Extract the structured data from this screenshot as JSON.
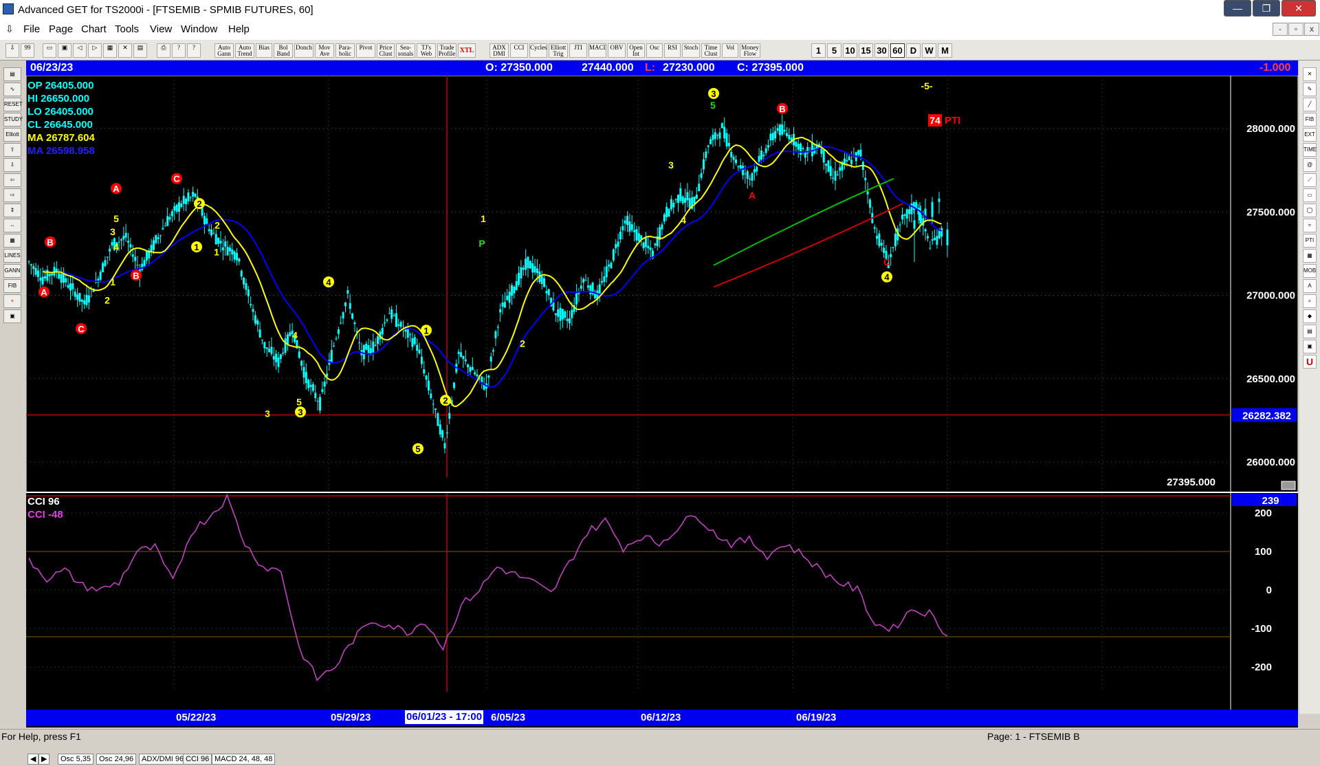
{
  "window": {
    "title": "Advanced GET for TS2000i - [FTSEMIB - SPMIB FUTURES, 60]",
    "controls": [
      "—",
      "❐",
      "✕"
    ]
  },
  "menu": {
    "items": [
      "File",
      "Page",
      "Chart",
      "Tools",
      "View",
      "Window",
      "Help"
    ],
    "mdi_controls": [
      "-",
      "▫",
      "x"
    ]
  },
  "toolbar": {
    "indicator_buttons": [
      "Auto Gann",
      "Auto Trend",
      "Bias",
      "Bol Band",
      "Donch",
      "Mov Ave",
      "Para-bolic",
      "Pivot",
      "Price Clust",
      "Sea-sonals",
      "TJ's Web",
      "Trade Profile",
      "XTL",
      "ADX DMI",
      "CCI",
      "Cycles",
      "Elliott Trig",
      "JTI",
      "MACD",
      "OBV",
      "Open Int",
      "Osc",
      "RSI",
      "Stoch",
      "Time Clust",
      "Vol",
      "Money Flow"
    ],
    "periods": [
      "1",
      "5",
      "10",
      "15",
      "30",
      "60",
      "D",
      "W",
      "M"
    ],
    "active_period": "60"
  },
  "header": {
    "date": "06/23/23",
    "open": "O: 27350.000",
    "high": "27440.000",
    "low_label": "L:",
    "low_value": "27230.000",
    "close": "C: 27395.000",
    "change": "-1.000"
  },
  "legend": {
    "op": "OP  26405.000",
    "hi": "HI   26650.000",
    "lo": "LO  26405.000",
    "cl": "CL  26645.000",
    "ma1": "MA  26787.604",
    "ma2": "MA  26598.958"
  },
  "price_axis": {
    "ticks": [
      "28000.000",
      "27500.000",
      "27000.000",
      "26500.000",
      "26000.000"
    ],
    "cursor_value": "26282.382",
    "last_value": "27395.000"
  },
  "wave_labels": {
    "top_right_marker": "-5-",
    "pti_value": "74",
    "pti_label": "PTI"
  },
  "cci_pane": {
    "title": "CCI 96",
    "value_label": "CCI  -48",
    "current_value": "239",
    "ticks": [
      "200",
      "100",
      "0",
      "-100",
      "-200"
    ]
  },
  "tabs": [
    "Osc 5,35",
    "Osc 24,96",
    "ADX/DMI 96",
    "CCI 96",
    "MACD 24, 48, 48"
  ],
  "date_axis": {
    "labels": [
      "05/22/23",
      "05/29/23",
      "6/05/23",
      "06/12/23",
      "06/19/23"
    ],
    "cursor_date": "06/01/23 - 17:00"
  },
  "status": {
    "help": "For Help, press F1",
    "page": "Page: 1 - FTSEMIB B"
  },
  "colors": {
    "background": "#000000",
    "header_bar": "#0000f0",
    "candles": "#00ffff",
    "ma_fast": "#ffff00",
    "ma_slow": "#0000ff",
    "cci_line": "#c040c0",
    "wave_yellow": "#ffff00",
    "wave_red": "#ff0000",
    "green_line": "#00c000",
    "red_line": "#d00000"
  },
  "chart_data": [
    {
      "type": "candlestick",
      "title": "FTSEMIB - SPMIB FUTURES, 60",
      "y_ticks": [
        28000,
        27500,
        27000,
        26500,
        26000
      ],
      "ylim": [
        25900,
        28300
      ],
      "x_labels": [
        "05/22/23",
        "05/29/23",
        "6/05/23",
        "06/12/23",
        "06/19/23"
      ],
      "close_path": [
        27200,
        27100,
        27150,
        27050,
        26950,
        27100,
        27300,
        27350,
        27150,
        27300,
        27450,
        27550,
        27600,
        27400,
        27300,
        27250,
        26950,
        26700,
        26600,
        26800,
        26500,
        26350,
        26700,
        27000,
        26650,
        26700,
        26900,
        26800,
        26700,
        26400,
        26100,
        26650,
        26550,
        26450,
        26900,
        27050,
        27200,
        27100,
        26900,
        26850,
        27100,
        27000,
        27200,
        27450,
        27350,
        27250,
        27500,
        27600,
        27550,
        27900,
        28000,
        27800,
        27700,
        27850,
        28000,
        27950,
        27850,
        27900,
        27700,
        27800,
        27850,
        27400,
        27200,
        27450,
        27550,
        27300,
        27395
      ],
      "last_ohlc": {
        "open": 27350,
        "high": 27440,
        "low": 27230,
        "close": 27395
      },
      "moving_averages": [
        {
          "name": "MA",
          "value": 26787.604,
          "color": "yellow"
        },
        {
          "name": "MA",
          "value": 26598.958,
          "color": "blue"
        }
      ],
      "wave_counts": [
        {
          "label": "A",
          "color": "red",
          "price": 26960
        },
        {
          "label": "B",
          "color": "red",
          "price": 27280
        },
        {
          "label": "C",
          "color": "red",
          "price": 26740
        },
        {
          "label": "A",
          "color": "red",
          "price": 27610
        },
        {
          "label": "B",
          "color": "red",
          "price": 27050
        },
        {
          "label": "C",
          "color": "red",
          "price": 27690
        },
        {
          "label": "3",
          "color": "yellow",
          "price": 26250
        },
        {
          "label": "4",
          "color": "yellow",
          "price": 27060
        },
        {
          "label": "1",
          "color": "yellow",
          "price": 26750
        },
        {
          "label": "5",
          "color": "yellow",
          "price": 26060
        },
        {
          "label": "2",
          "color": "yellow",
          "price": 26350
        },
        {
          "label": "3",
          "color": "yellow",
          "price": 28190
        },
        {
          "label": "B",
          "color": "red",
          "price": 28100
        },
        {
          "label": "C",
          "color": "red",
          "price": 27180
        },
        {
          "label": "4",
          "color": "yellow",
          "price": 27090
        },
        {
          "label": "A",
          "color": "red",
          "price": 27550
        }
      ]
    },
    {
      "type": "line",
      "title": "CCI 96",
      "y_ticks": [
        200,
        100,
        0,
        -100,
        -200
      ],
      "ylim": [
        -260,
        260
      ],
      "series": [
        {
          "name": "CCI",
          "values": [
            80,
            30,
            50,
            10,
            0,
            20,
            100,
            110,
            20,
            150,
            190,
            240,
            120,
            60,
            50,
            -150,
            -230,
            -200,
            -130,
            -80,
            -90,
            -110,
            -80,
            -150,
            -40,
            0,
            60,
            40,
            20,
            -10,
            70,
            150,
            180,
            110,
            140,
            120,
            160,
            200,
            150,
            120,
            130,
            90,
            120,
            90,
            50,
            20,
            0,
            -90,
            -100,
            -50,
            -60,
            -120
          ]
        }
      ]
    }
  ]
}
